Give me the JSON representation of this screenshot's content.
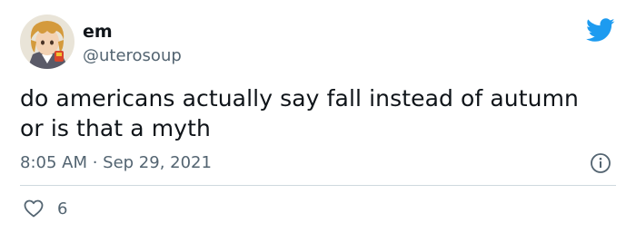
{
  "author": {
    "display_name": "em",
    "handle": "@uterosoup",
    "avatar_icon": "anime-character-avatar"
  },
  "tweet": {
    "text_lines": [
      "do americans actually say fall instead of autumn",
      "or is that a myth"
    ],
    "timestamp": "8:05 AM · Sep 29, 2021"
  },
  "actions": {
    "like_icon": "heart-icon",
    "like_count": "6",
    "info_icon": "info-icon"
  },
  "brand": {
    "icon": "twitter-bird-icon",
    "color": "#1d9bf0"
  },
  "colors": {
    "text_primary": "#0f1419",
    "text_secondary": "#536471",
    "divider": "#cfd9de"
  }
}
